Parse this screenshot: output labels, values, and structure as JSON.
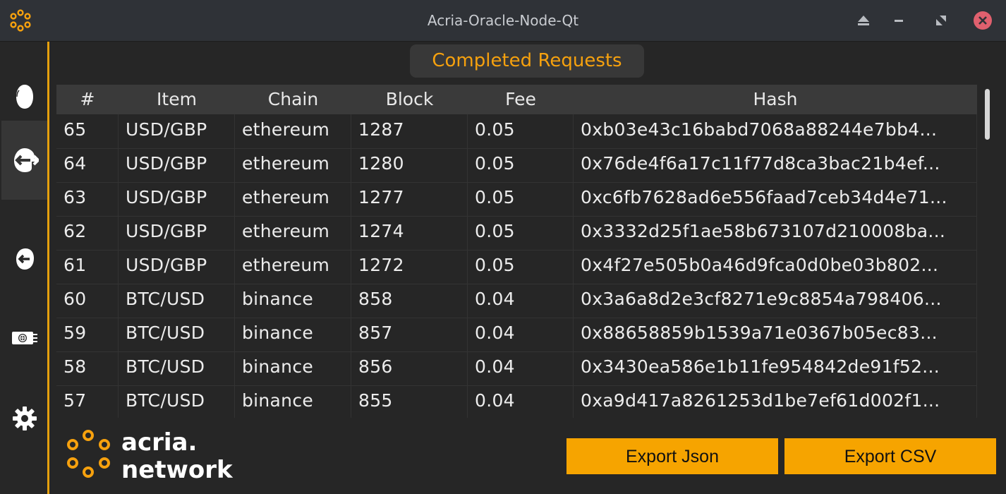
{
  "window": {
    "title": "Acria-Oracle-Node-Qt",
    "accent_color": "#f6a10e",
    "close_color": "#e0606e"
  },
  "sidebar": {
    "items": [
      {
        "icon": "cloud-icon"
      },
      {
        "icon": "outgoing-request-icon",
        "active": true
      },
      {
        "icon": "incoming-request-icon"
      },
      {
        "icon": "money-globe-icon"
      },
      {
        "icon": "gear-icon"
      }
    ]
  },
  "main": {
    "heading": "Completed Requests",
    "columns": [
      "#",
      "Item",
      "Chain",
      "Block",
      "Fee",
      "Hash"
    ],
    "rows": [
      [
        "65",
        "USD/GBP",
        "ethereum",
        "1287",
        "0.05",
        "0xb03e43c16babd7068a88244e7bb4..."
      ],
      [
        "64",
        "USD/GBP",
        "ethereum",
        "1280",
        "0.05",
        "0x76de4f6a17c11f77d8ca3bac21b4ef..."
      ],
      [
        "63",
        "USD/GBP",
        "ethereum",
        "1277",
        "0.05",
        "0xc6fb7628ad6e556faad7ceb34d4e71..."
      ],
      [
        "62",
        "USD/GBP",
        "ethereum",
        "1274",
        "0.05",
        "0x3332d25f1ae58b673107d210008ba..."
      ],
      [
        "61",
        "USD/GBP",
        "ethereum",
        "1272",
        "0.05",
        "0x4f27e505b0a46d9fca0d0be03b802..."
      ],
      [
        "60",
        "BTC/USD",
        "binance",
        "858",
        "0.04",
        "0x3a6a8d2e3cf8271e9c8854a798406..."
      ],
      [
        "59",
        "BTC/USD",
        "binance",
        "857",
        "0.04",
        "0x88658859b1539a71e0367b05ec83..."
      ],
      [
        "58",
        "BTC/USD",
        "binance",
        "856",
        "0.04",
        "0x3430ea586e1b11fe954842de91f52..."
      ],
      [
        "57",
        "BTC/USD",
        "binance",
        "855",
        "0.04",
        "0xa9d417a8261253d1be7ef61d002f1..."
      ]
    ]
  },
  "footer": {
    "logo_line1": "acria.",
    "logo_line2": "network",
    "export_json_label": "Export Json",
    "export_csv_label": "Export CSV"
  }
}
